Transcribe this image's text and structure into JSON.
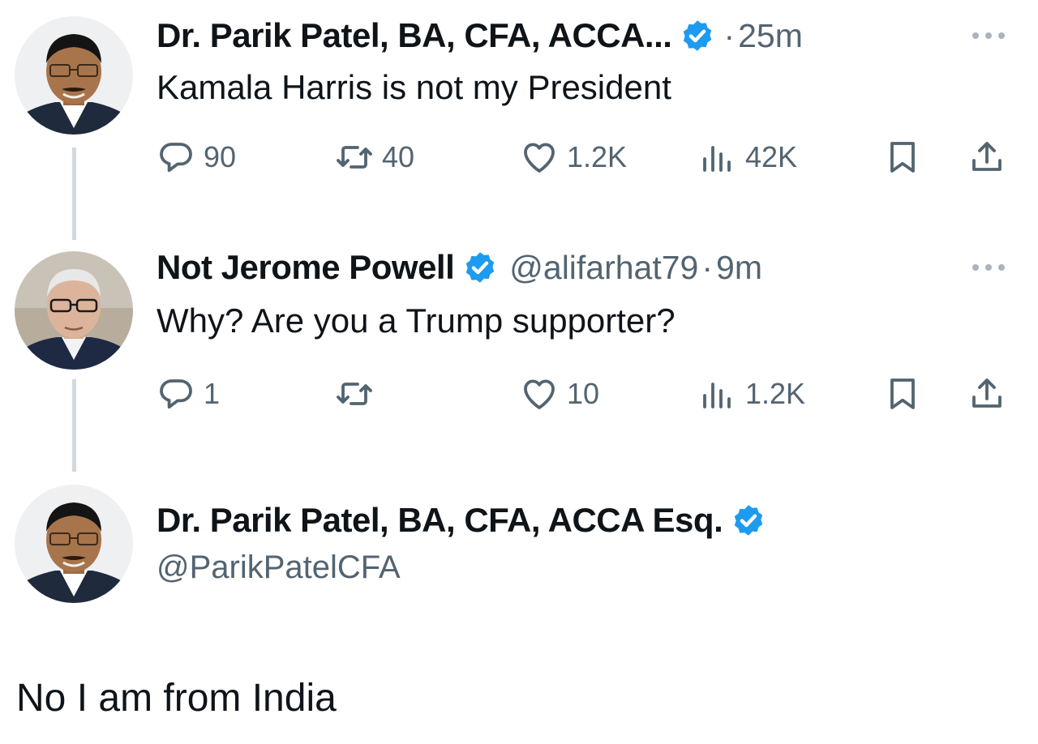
{
  "tweets": [
    {
      "name": "Dr. Parik Patel, BA, CFA, ACCA...",
      "dot": "·",
      "time": "25m",
      "text": "Kamala Harris is not my President",
      "replies": "90",
      "retweets": "40",
      "likes": "1.2K",
      "views": "42K"
    },
    {
      "name": "Not Jerome Powell",
      "handle": "@alifarhat79",
      "dot": "·",
      "time": "9m",
      "text": "Why? Are you a Trump supporter?",
      "replies": "1",
      "retweets": "",
      "likes": "10",
      "views": "1.2K"
    }
  ],
  "reply_author": {
    "name": "Dr. Parik Patel, BA, CFA, ACCA Esq.",
    "handle": "@ParikPatelCFA"
  },
  "caption": "No I am from India",
  "colors": {
    "text": "#0f1419",
    "secondary": "#536471",
    "verified": "#1d9bf0",
    "thread_line": "#cfd9de"
  },
  "icons": {
    "reply": "reply-icon",
    "retweet": "retweet-icon",
    "like": "heart-icon",
    "views": "views-icon",
    "bookmark": "bookmark-icon",
    "share": "share-icon",
    "verified": "verified-badge-icon",
    "more": "more-icon"
  }
}
